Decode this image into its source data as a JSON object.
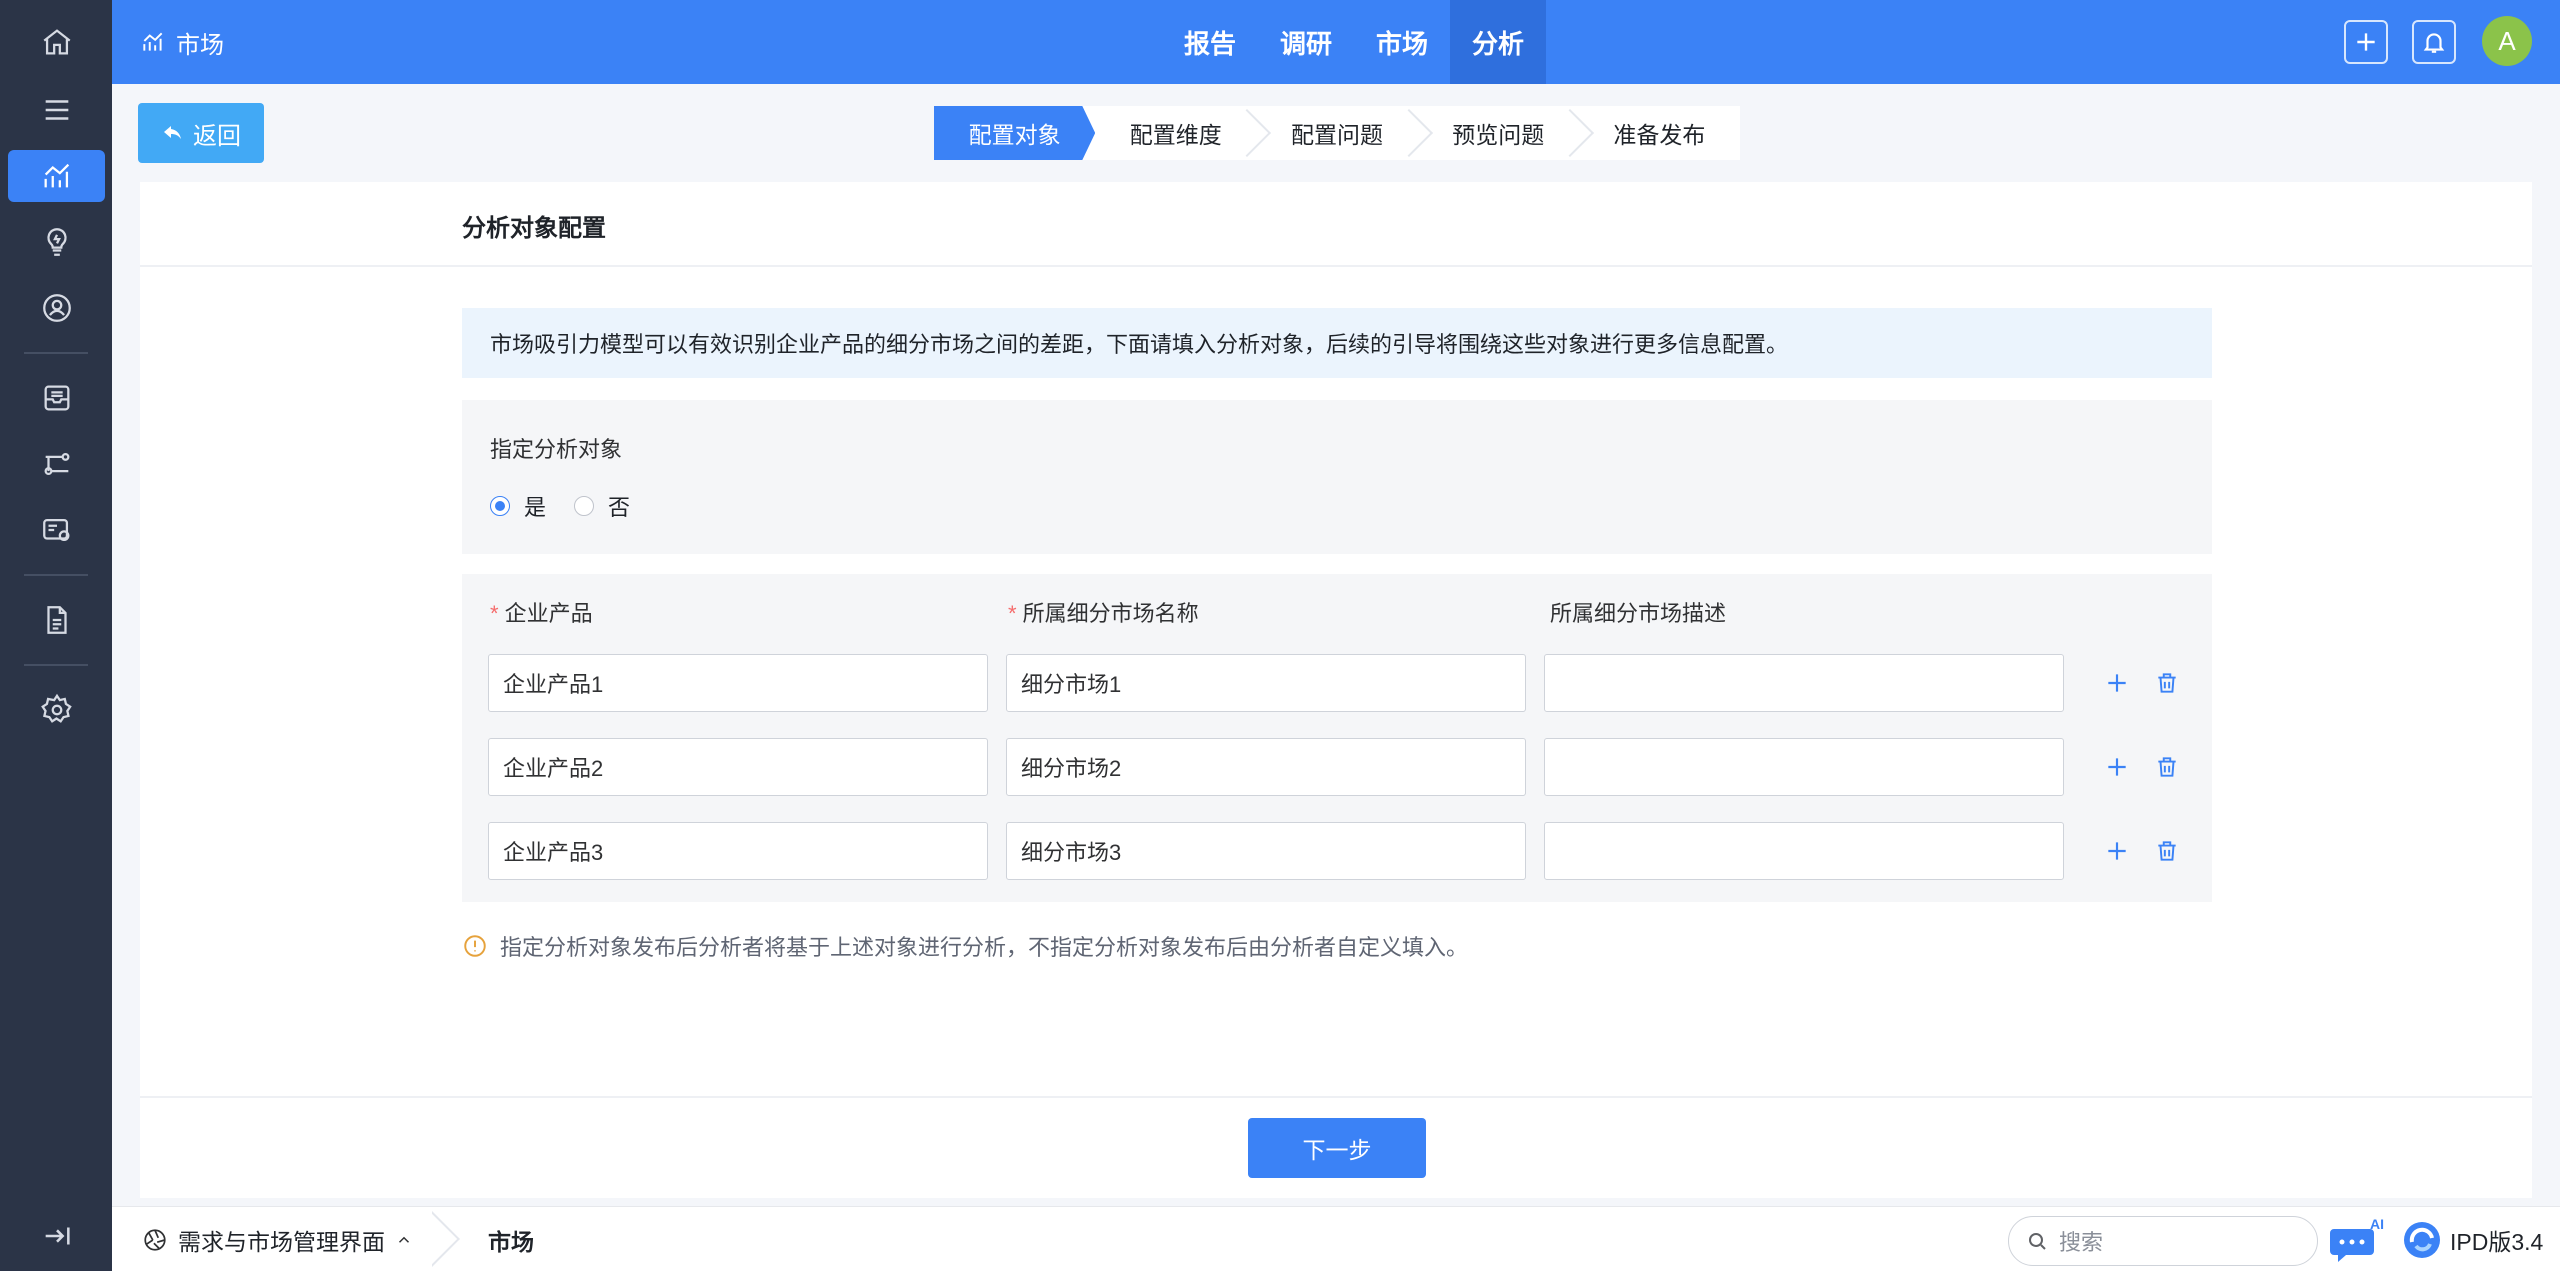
{
  "sidebar": {
    "items": [
      {
        "icon": "home-icon"
      },
      {
        "icon": "menu-icon"
      },
      {
        "icon": "chart-trend-icon",
        "active": true
      },
      {
        "icon": "lightbulb-icon"
      },
      {
        "icon": "user-circle-icon"
      },
      {
        "icon": "inbox-icon"
      },
      {
        "icon": "flow-icon"
      },
      {
        "icon": "card-icon"
      },
      {
        "icon": "document-icon"
      },
      {
        "icon": "gear-icon"
      },
      {
        "icon": "collapse-icon"
      }
    ]
  },
  "header": {
    "brand": "市场",
    "nav": [
      "报告",
      "调研",
      "市场",
      "分析"
    ],
    "active_nav": "分析",
    "avatar_letter": "A"
  },
  "toolbar": {
    "back_label": "返回",
    "steps": [
      "配置对象",
      "配置维度",
      "配置问题",
      "预览问题",
      "准备发布"
    ],
    "active_step": 0
  },
  "card": {
    "title": "分析对象配置",
    "info": "市场吸引力模型可以有效识别企业产品的细分市场之间的差距，下面请填入分析对象，后续的引导将围绕这些对象进行更多信息配置。",
    "specify_label": "指定分析对象",
    "radio_yes": "是",
    "radio_no": "否",
    "radio_selected": "是",
    "columns": {
      "product": "企业产品",
      "segment": "所属细分市场名称",
      "desc": "所属细分市场描述"
    },
    "rows": [
      {
        "product": "企业产品1",
        "segment": "细分市场1",
        "desc": ""
      },
      {
        "product": "企业产品2",
        "segment": "细分市场2",
        "desc": ""
      },
      {
        "product": "企业产品3",
        "segment": "细分市场3",
        "desc": ""
      }
    ],
    "tip": "指定分析对象发布后分析者将基于上述对象进行分析，不指定分析对象发布后由分析者自定义填入。",
    "next_label": "下一步"
  },
  "bottombar": {
    "workspace": "需求与市场管理界面",
    "crumb": "市场",
    "search_placeholder": "搜索",
    "ai_label": "AI",
    "version": "IPD版3.4"
  },
  "colors": {
    "primary": "#3b82f6",
    "sidebar": "#2b3447",
    "back_button": "#42a9f5",
    "required": "#f56c6c",
    "warning": "#e6a23c"
  }
}
